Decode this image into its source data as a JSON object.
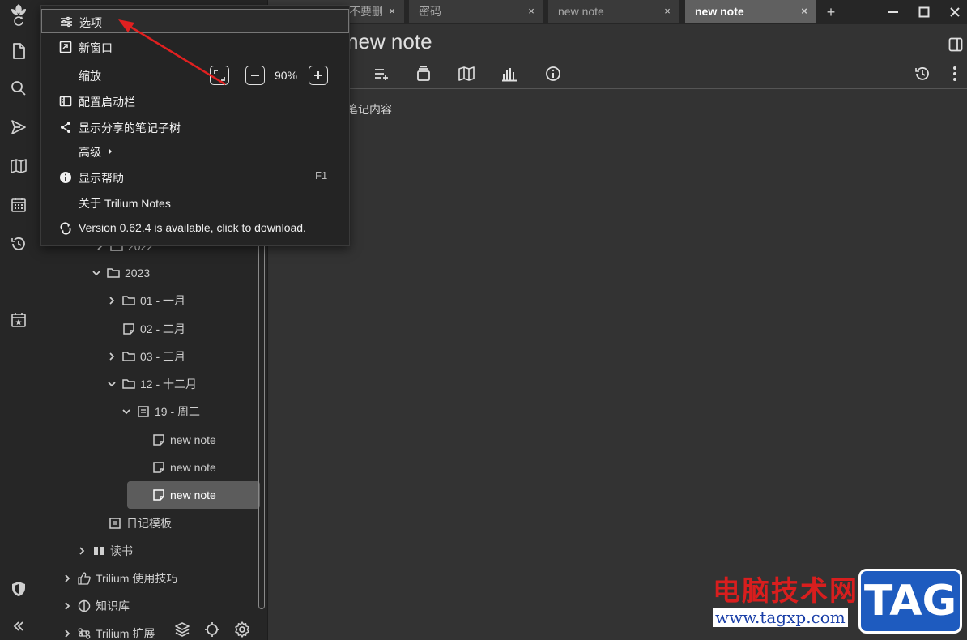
{
  "tabs": [
    {
      "label": "不要删",
      "active": false
    },
    {
      "label": "密码",
      "active": false
    },
    {
      "label": "new note",
      "active": false
    },
    {
      "label": "new note",
      "active": true
    }
  ],
  "tab_close": "×",
  "new_tab": "+",
  "note": {
    "title": "new note",
    "content": "笔记内容"
  },
  "menu": {
    "options": "选项",
    "new_window": "新窗口",
    "zoom": "缩放",
    "zoom_value": "90%",
    "configure_launchbar": "配置启动栏",
    "show_shared_tree": "显示分享的笔记子树",
    "advanced": "高级",
    "show_help": "显示帮助",
    "help_shortcut": "F1",
    "about": "关于 Trilium Notes",
    "version": "Version 0.62.4 is available, click to download."
  },
  "tree": [
    {
      "label": "2022",
      "type": "folder",
      "expandable": true,
      "expanded": false
    },
    {
      "label": "2023",
      "type": "folder",
      "expandable": true,
      "expanded": true
    },
    {
      "label": "01 - 一月",
      "type": "folder",
      "expandable": true,
      "expanded": false
    },
    {
      "label": "02 - 二月",
      "type": "note",
      "expandable": false
    },
    {
      "label": "03 - 三月",
      "type": "folder",
      "expandable": true,
      "expanded": false
    },
    {
      "label": "12 - 十二月",
      "type": "folder",
      "expandable": true,
      "expanded": true
    },
    {
      "label": "19 - 周二",
      "type": "day",
      "expandable": true,
      "expanded": true
    },
    {
      "label": "new note",
      "type": "note",
      "expandable": false
    },
    {
      "label": "new note",
      "type": "note",
      "expandable": false
    },
    {
      "label": "new note",
      "type": "note",
      "expandable": false,
      "active": true
    },
    {
      "label": "日记模板",
      "type": "template",
      "expandable": false
    },
    {
      "label": "读书",
      "type": "book",
      "expandable": true,
      "expanded": false
    },
    {
      "label": "Trilium 使用技巧",
      "type": "thumb",
      "expandable": true,
      "expanded": false
    },
    {
      "label": "知识库",
      "type": "brain",
      "expandable": true,
      "expanded": false
    },
    {
      "label": "Trilium 扩展",
      "type": "command",
      "expandable": true,
      "expanded": false
    }
  ],
  "watermark": {
    "site_name": "电脑技术网",
    "url": "www.tagxp.com",
    "tag": "TAG"
  },
  "colors": {
    "accent_arrow": "#e02020",
    "active_tab": "#606060",
    "background": "#333333"
  }
}
